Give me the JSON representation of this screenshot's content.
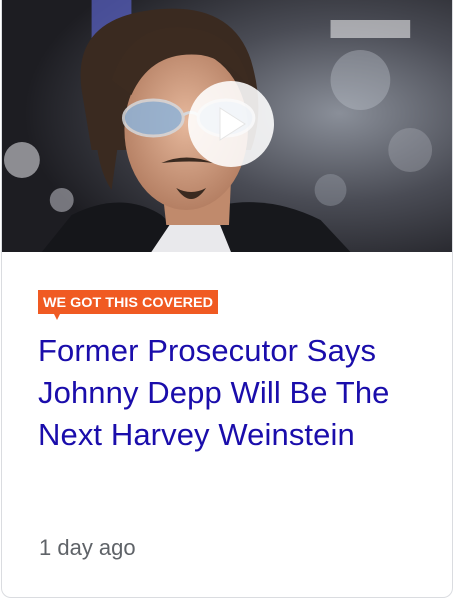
{
  "card": {
    "source_logo_text": "WE GOT THIS COVERED",
    "headline": "Former Prosecutor Says Johnny Depp Will Be The Next Harvey Weinstein",
    "timestamp": "1 day ago",
    "play_icon": "play-icon"
  },
  "colors": {
    "headline": "#1a0dab",
    "timestamp": "#5f6368",
    "source_logo": "#f05a22",
    "border": "#dadce0"
  }
}
